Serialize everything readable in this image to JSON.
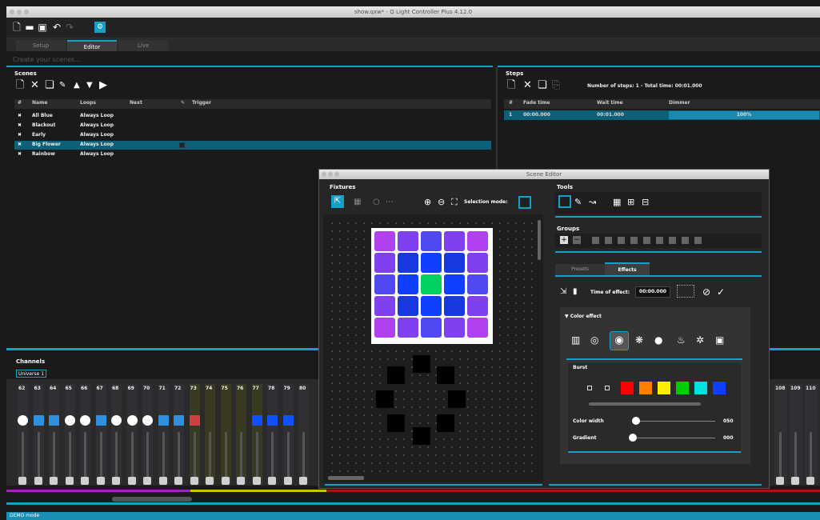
{
  "window": {
    "title": "show.qxw* - Q Light Controller Plus 4.12.0"
  },
  "toolbar": {
    "icons": [
      "new-icon",
      "open-icon",
      "save-icon",
      "undo-icon",
      "redo-icon",
      "settings-icon"
    ]
  },
  "tabs": [
    {
      "label": "Setup"
    },
    {
      "label": "Editor"
    },
    {
      "label": "Live"
    }
  ],
  "hint": "Create your scenes...",
  "scenes": {
    "title": "Scenes",
    "columns": [
      "#",
      "Name",
      "Loops",
      "Next",
      "",
      "Trigger"
    ],
    "rows": [
      {
        "name": "All Blue",
        "loops": "Always Loop"
      },
      {
        "name": "Blackout",
        "loops": "Always Loop"
      },
      {
        "name": "Early",
        "loops": "Always Loop"
      },
      {
        "name": "Big Flower",
        "loops": "Always Loop"
      },
      {
        "name": "Rainbow",
        "loops": "Always Loop"
      }
    ]
  },
  "steps": {
    "title": "Steps",
    "info": "Number of steps: 1 - Total time: 00:01.000",
    "columns": [
      "#",
      "Fade time",
      "Wait time",
      "Dimmer"
    ],
    "rows": [
      {
        "num": "1",
        "fade": "00:00.000",
        "wait": "00:01.000",
        "dimmer": "100%"
      }
    ]
  },
  "editor": {
    "title": "Scene Editor",
    "fixtures_title": "Fixtures",
    "selection_mode": "Selection mode:",
    "tools_title": "Tools",
    "groups_title": "Groups",
    "tabs": [
      {
        "label": "Presets"
      },
      {
        "label": "Effects"
      }
    ],
    "time_of_effect_label": "Time of effect:",
    "time_of_effect_value": "00:00.000",
    "color_effect_label": "Color effect",
    "burst_label": "Burst",
    "color_width_label": "Color width",
    "color_width_value": "050",
    "gradient_label": "Gradient",
    "gradient_value": "000",
    "colors": [
      "#ff0000",
      "#ff8000",
      "#ffee00",
      "#00cc00",
      "#00e0e0",
      "#1040ff"
    ]
  },
  "channels": {
    "title": "Channels",
    "universe": "Universe 1",
    "left_numbers": [
      "62",
      "63",
      "64",
      "65",
      "66",
      "67",
      "68",
      "69",
      "70",
      "71",
      "72",
      "73",
      "74",
      "75",
      "76",
      "77",
      "78",
      "79",
      "80"
    ],
    "right_numbers": [
      "108",
      "109",
      "110"
    ]
  },
  "status": "DEMO mode"
}
